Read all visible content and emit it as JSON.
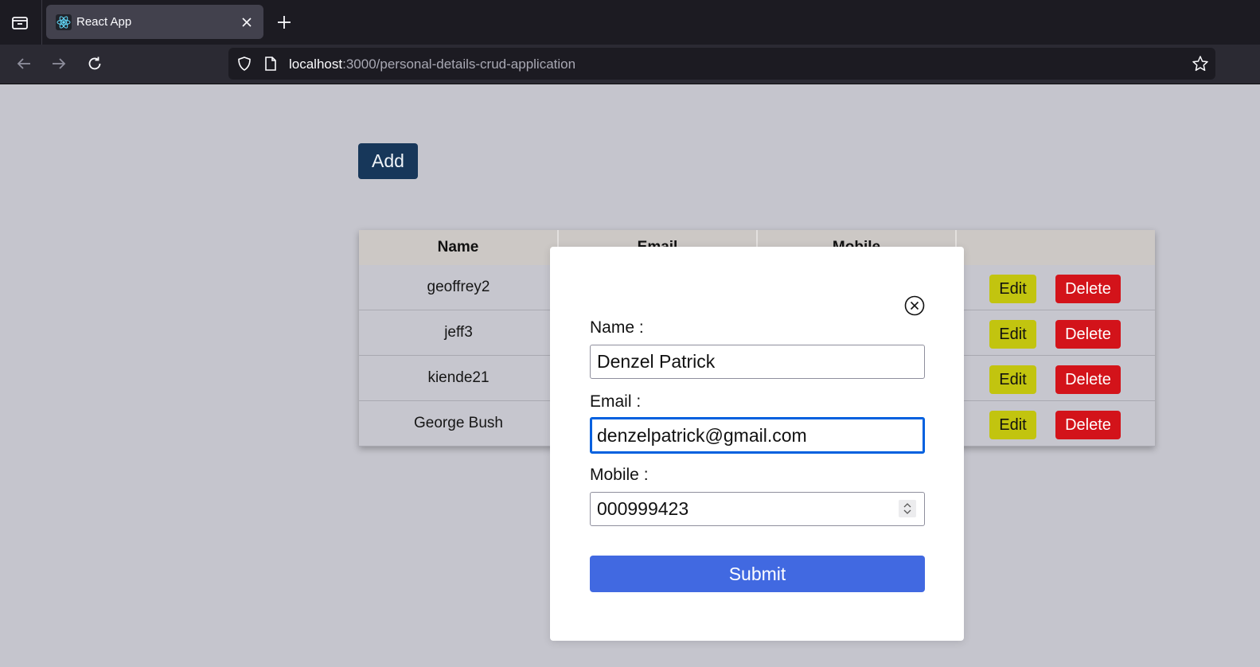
{
  "browser": {
    "tab_title": "React App",
    "url_host": "localhost",
    "url_rest": ":3000/personal-details-crud-application"
  },
  "page": {
    "add_label": "Add",
    "table": {
      "headers": [
        "Name",
        "Email",
        "Mobile",
        ""
      ],
      "rows": [
        {
          "name": "geoffrey2"
        },
        {
          "name": "jeff3"
        },
        {
          "name": "kiende21"
        },
        {
          "name": "George Bush"
        }
      ],
      "edit_label": "Edit",
      "delete_label": "Delete"
    }
  },
  "modal": {
    "name_label": "Name :",
    "name_value": "Denzel Patrick",
    "email_label": "Email :",
    "email_value": "denzelpatrick@gmail.com",
    "mobile_label": "Mobile :",
    "mobile_value": "000999423",
    "submit_label": "Submit"
  },
  "colors": {
    "add_button": "#17375a",
    "edit_button": "#c2c40f",
    "delete_button": "#d3131a",
    "submit_button": "#4169e1"
  }
}
